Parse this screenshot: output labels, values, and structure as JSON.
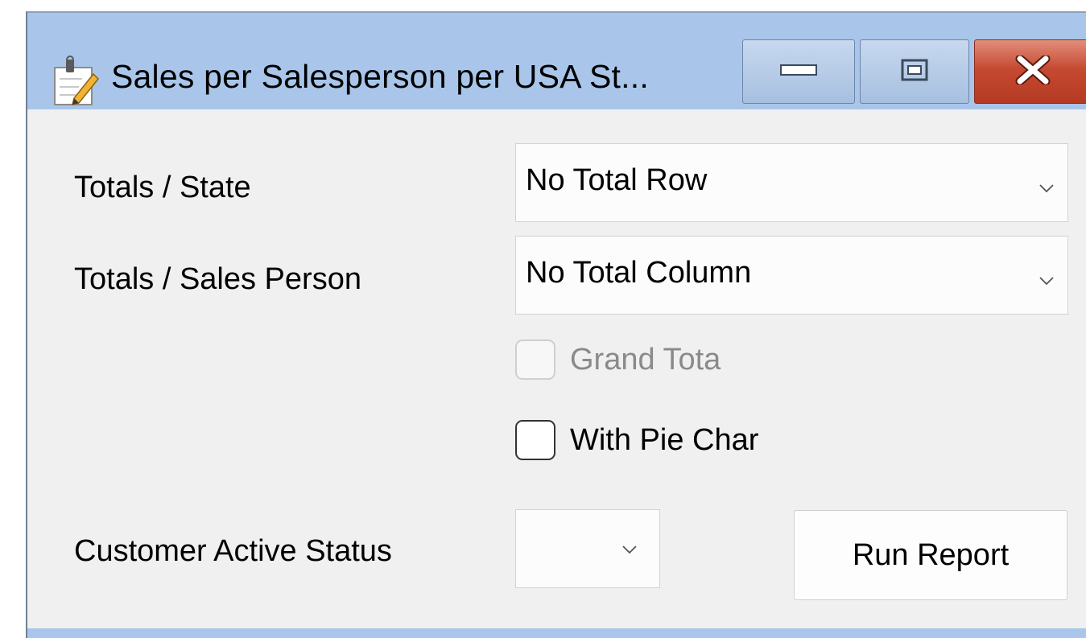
{
  "window": {
    "title": "Sales per Salesperson per USA St...",
    "icon": "notepad-pencil-icon",
    "controls": {
      "minimize": "minimize-icon",
      "maximize": "maximize-icon",
      "close": "close-icon"
    }
  },
  "form": {
    "totals_state": {
      "label": "Totals / State",
      "value": "No Total Row"
    },
    "totals_sales_person": {
      "label": "Totals / Sales Person",
      "value": "No Total Column"
    },
    "grand_total": {
      "label": "Grand Tota",
      "checked": false,
      "enabled": false
    },
    "with_pie_chart": {
      "label": "With Pie Char",
      "checked": false,
      "enabled": true
    },
    "customer_active_status": {
      "label": "Customer Active Status",
      "value": ""
    },
    "run_report": {
      "label": "Run Report"
    }
  },
  "colors": {
    "titlebar": "#a9c6ea",
    "client_bg": "#f0f0f0",
    "close_button": "#c64a32"
  }
}
